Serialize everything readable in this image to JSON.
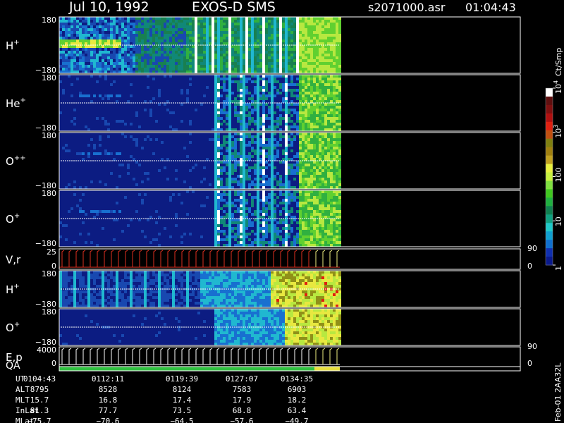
{
  "header": {
    "date": "Jul 10, 1992",
    "instrument": "EXOS-D SMS",
    "filename": "s2071000.asr",
    "time": "01:04:43"
  },
  "colorbar": {
    "unit_label": "Ct/Smp",
    "tick_labels": [
      "1",
      "10",
      "100",
      "10",
      "10"
    ],
    "tick_superscripts": [
      "",
      "",
      "",
      "3",
      "4"
    ],
    "colors": [
      "#0a1a8c",
      "#1030b0",
      "#1070d0",
      "#10a0d0",
      "#20c8c8",
      "#10a080",
      "#108050",
      "#20b040",
      "#40c820",
      "#80e040",
      "#c8f040",
      "#e8f040",
      "#c0a020",
      "#a08010",
      "#808010",
      "#c05010",
      "#e02010",
      "#b01010",
      "#801010",
      "#601010",
      "#ffffff"
    ]
  },
  "panels": [
    {
      "id": "h-plus",
      "label": "H",
      "sup": "+",
      "ytop": "180",
      "ybot": "−180"
    },
    {
      "id": "he-plus",
      "label": "He",
      "sup": "+",
      "ytop": "180",
      "ybot": "−180"
    },
    {
      "id": "o-plusplus",
      "label": "O",
      "sup": "++",
      "ytop": "180",
      "ybot": "−180"
    },
    {
      "id": "o-plus",
      "label": "O",
      "sup": "+",
      "ytop": "180",
      "ybot": "−180"
    },
    {
      "id": "vr",
      "label": "V,r",
      "sup": "",
      "ytop": "25",
      "ybot": "0",
      "right_top": "90",
      "right_bot": "0"
    },
    {
      "id": "h-plus-2",
      "label": "H",
      "sup": "+",
      "ytop": "180",
      "ybot": "−180"
    },
    {
      "id": "o-plus-2",
      "label": "O",
      "sup": "+",
      "ytop": "180",
      "ybot": "−180"
    },
    {
      "id": "ep",
      "label": "E,p",
      "sup": "",
      "ytop": "4000",
      "ybot": "0",
      "right_top": "90",
      "right_bot": "0"
    },
    {
      "id": "qa",
      "label": "QA",
      "sup": "",
      "ytop": "",
      "ybot": ""
    }
  ],
  "ephemeris": {
    "rows": [
      {
        "name": "UT",
        "values": [
          "0104:43",
          "0112:11",
          "0119:39",
          "0127:07",
          "0134:35"
        ]
      },
      {
        "name": "ALT",
        "values": [
          "8795",
          "8528",
          "8124",
          "7583",
          "6903"
        ]
      },
      {
        "name": "MLT",
        "values": [
          "15.7",
          "16.8",
          "17.4",
          "17.9",
          "18.2"
        ]
      },
      {
        "name": "InLat",
        "values": [
          "81.3",
          "77.7",
          "73.5",
          "68.8",
          "63.4"
        ]
      },
      {
        "name": "MLat",
        "values": [
          "−75.7",
          "−70.6",
          "−64.5",
          "−57.6",
          "−49.7"
        ]
      }
    ]
  },
  "footer_code": "Feb-01 2AA32L",
  "chart_data": {
    "type": "heatmap",
    "title": "Jul 10, 1992   EXOS-D SMS",
    "x_tick_labels": [
      "0104:43",
      "0112:11",
      "0119:39",
      "0127:07",
      "0134:35"
    ],
    "data_coverage_fraction": 0.6,
    "colorbar_range_log10": [
      0,
      4
    ],
    "panels": [
      {
        "label": "H+",
        "yrange": [
          -180,
          180
        ]
      },
      {
        "label": "He+",
        "yrange": [
          -180,
          180
        ]
      },
      {
        "label": "O++",
        "yrange": [
          -180,
          180
        ]
      },
      {
        "label": "O+",
        "yrange": [
          -180,
          180
        ]
      },
      {
        "label": "V,r",
        "yrange": [
          0,
          25
        ],
        "right_yrange": [
          0,
          90
        ]
      },
      {
        "label": "H+",
        "yrange": [
          -180,
          180
        ]
      },
      {
        "label": "O+",
        "yrange": [
          -180,
          180
        ]
      },
      {
        "label": "E,p",
        "yrange": [
          0,
          4000
        ],
        "right_yrange": [
          0,
          90
        ]
      },
      {
        "label": "QA"
      }
    ]
  }
}
